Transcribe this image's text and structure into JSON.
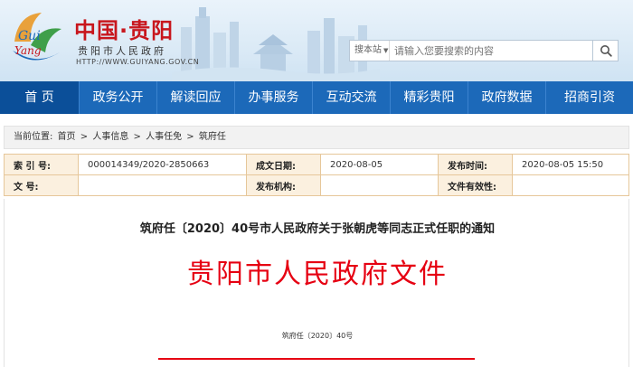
{
  "header": {
    "logo_text": "You Guiyang",
    "site_title": "中国·贵阳",
    "site_subtitle": "贵阳市人民政府",
    "site_url": "HTTP://WWW.GUIYANG.GOV.CN",
    "search_scope": "搜本站",
    "search_placeholder": "请输入您要搜索的内容"
  },
  "nav": {
    "items": [
      "首 页",
      "政务公开",
      "解读回应",
      "办事服务",
      "互动交流",
      "精彩贵阳",
      "政府数据",
      "招商引资"
    ],
    "active_index": 0
  },
  "breadcrumb": {
    "prefix": "当前位置:",
    "items": [
      "首页",
      "人事信息",
      "人事任免",
      "筑府任"
    ],
    "separator": ">"
  },
  "meta": {
    "index_label": "索 引 号:",
    "index_value": "000014349/2020-2850663",
    "created_label": "成文日期:",
    "created_value": "2020-08-05",
    "published_label": "发布时间:",
    "published_value": "2020-08-05 15:50",
    "docno_label": "文    号:",
    "docno_value": "",
    "issuer_label": "发布机构:",
    "issuer_value": "",
    "validity_label": "文件有效性:",
    "validity_value": ""
  },
  "document": {
    "title": "筑府任〔2020〕40号市人民政府关于张朝虎等同志正式任职的通知",
    "red_header": "贵阳市人民政府文件",
    "doc_number": "筑府任〔2020〕40号"
  },
  "colors": {
    "nav_blue": "#1c69b9",
    "nav_active": "#0b4f99",
    "title_red": "#c8161d",
    "doc_red": "#e60012",
    "meta_key_bg": "#fbf0df"
  }
}
